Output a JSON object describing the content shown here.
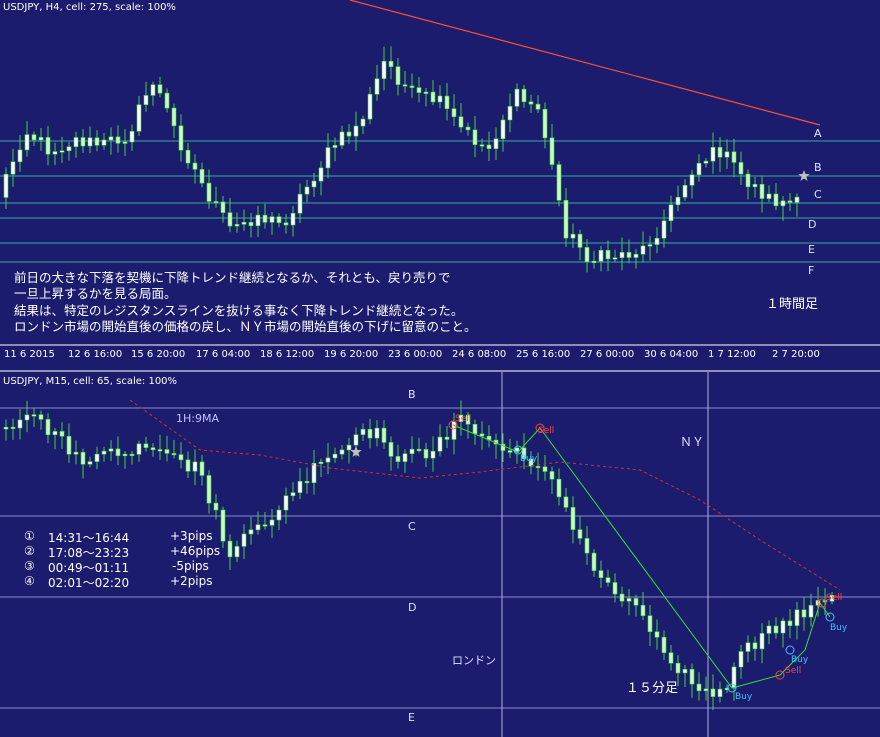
{
  "top_chart": {
    "header": "USDJPY, H4, cell: 275, scale: 100%",
    "level_labels": [
      "A",
      "B",
      "C",
      "D",
      "E",
      "F"
    ],
    "timeframe_label": "１時間足",
    "notes": [
      "前日の大きな下落を契機に下降トレンド継続となるか、それとも、戻り売りで",
      "一旦上昇するかを見る局面。",
      "結果は、特定のレジスタンスラインを抜ける事なく下降トレンド継続となった。",
      "ロンドン市場の開始直後の価格の戻し、ＮＹ市場の開始直後の下げに留意のこと。"
    ],
    "time_labels": [
      "11 6 2015",
      "12 6 16:00",
      "15 6 20:00",
      "17 6 04:00",
      "18 6 12:00",
      "19 6 20:00",
      "23 6 00:00",
      "24 6 08:00",
      "25 6 16:00",
      "27 6 00:00",
      "30 6 04:00",
      "1 7 12:00",
      "2 7 20:00"
    ]
  },
  "bottom_chart": {
    "header": "USDJPY, M15, cell: 65, scale: 100%",
    "level_labels": [
      "B",
      "C",
      "D",
      "E"
    ],
    "ma_label": "1H:9MA",
    "session_labels": {
      "ny": "ＮＹ",
      "london": "ロンドン"
    },
    "timeframe_label": "１５分足",
    "trade_labels": {
      "sell": "Sell",
      "buy": "Buy"
    },
    "results": [
      {
        "num": "①",
        "time": "14:31～16:44",
        "pips": "+3pips"
      },
      {
        "num": "②",
        "time": "17:08～23:23",
        "pips": "+46pips"
      },
      {
        "num": "③",
        "time": "00:49～01:11",
        "pips": "-5pips"
      },
      {
        "num": "④",
        "time": "02:01～02:20",
        "pips": "+2pips"
      }
    ]
  },
  "colors": {
    "background": "#1c1c6e",
    "level_line": "#3aa8a8",
    "trend_line": "#ff5030",
    "candle_bull": "#ffffff",
    "candle_bear": "#c8ffc0",
    "wick": "#40d040",
    "ma_line": "#d03030",
    "trade_path": "#30e030",
    "sell": "#ff4040",
    "buy": "#40c0ff",
    "star": "#c0c0c0"
  }
}
